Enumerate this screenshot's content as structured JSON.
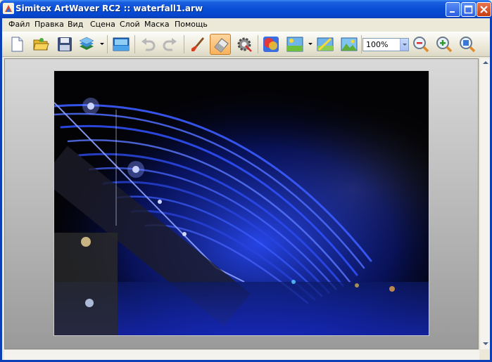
{
  "window": {
    "title": "Simitex ArtWaver RC2 :: waterfall1.arw"
  },
  "menu": {
    "items": [
      "Файл",
      "Правка",
      "Вид",
      "Сцена",
      "Слой",
      "Маска",
      "Помощь"
    ]
  },
  "toolbar": {
    "buttons": [
      {
        "name": "new-document-button",
        "icon": "new-document-icon"
      },
      {
        "name": "open-button",
        "icon": "folder-icon"
      },
      {
        "name": "save-button",
        "icon": "floppy-disk-icon"
      },
      {
        "name": "layers-button",
        "icon": "layers-icon"
      },
      {
        "name": "image-button",
        "icon": "landscape-image-icon"
      },
      {
        "name": "undo-button",
        "icon": "undo-icon"
      },
      {
        "name": "redo-button",
        "icon": "redo-icon"
      },
      {
        "name": "brush-tool-button",
        "icon": "paintbrush-icon"
      },
      {
        "name": "eraser-tool-button",
        "icon": "eraser-icon",
        "active": true
      },
      {
        "name": "settings-button",
        "icon": "gear-icon"
      },
      {
        "name": "colors-button",
        "icon": "color-palette-icon"
      },
      {
        "name": "effects-button",
        "icon": "image-effects-icon"
      },
      {
        "name": "filter-button",
        "icon": "image-filter-icon"
      },
      {
        "name": "landscape-button",
        "icon": "landscape-icon"
      },
      {
        "name": "zoom-out-button",
        "icon": "zoom-out-icon"
      },
      {
        "name": "zoom-in-button",
        "icon": "zoom-in-icon"
      },
      {
        "name": "zoom-fit-button",
        "icon": "zoom-fit-icon"
      }
    ],
    "zoom_value": "100%"
  },
  "colors": {
    "title_bar": "#0a4fd6",
    "canvas_accent": "#2a4cff",
    "workspace_bg": "#bdbdbd"
  }
}
